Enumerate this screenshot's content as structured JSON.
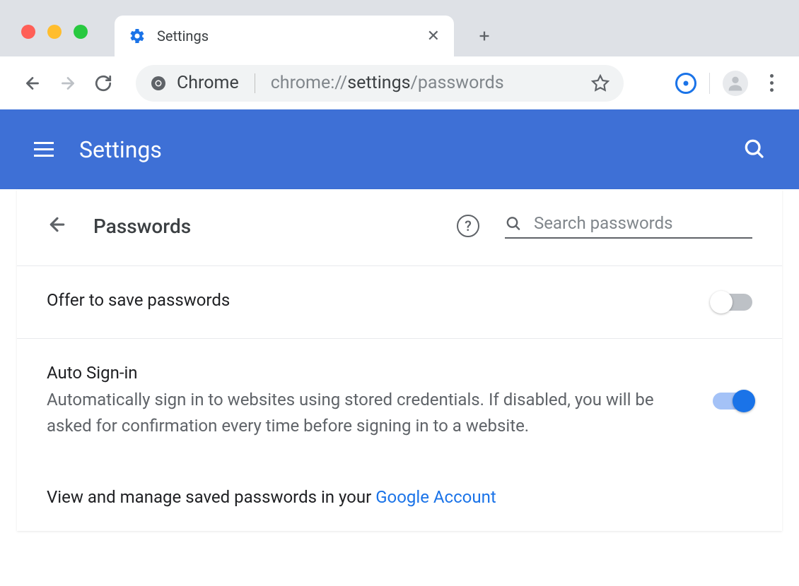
{
  "window": {
    "tab_title": "Settings"
  },
  "toolbar": {
    "scheme_label": "Chrome",
    "url_prefix": "chrome://",
    "url_bold": "settings",
    "url_suffix": "/passwords"
  },
  "header": {
    "title": "Settings"
  },
  "page": {
    "title": "Passwords",
    "search_placeholder": "Search passwords"
  },
  "settings": {
    "offer_save": {
      "title": "Offer to save passwords",
      "enabled": false
    },
    "auto_signin": {
      "title": "Auto Sign-in",
      "description": "Automatically sign in to websites using stored credentials. If disabled, you will be asked for confirmation every time before signing in to a website.",
      "enabled": true
    },
    "link": {
      "prefix": "View and manage saved passwords in your ",
      "link_text": "Google Account"
    }
  }
}
